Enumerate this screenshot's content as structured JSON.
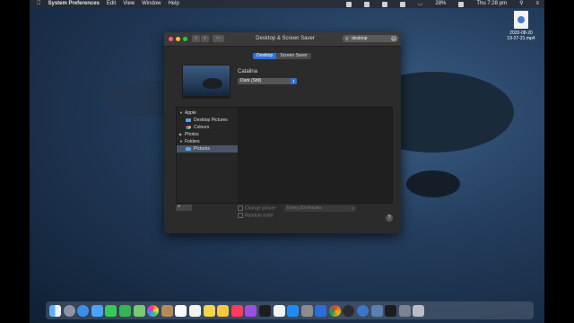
{
  "menubar": {
    "apple_icon": "apple-logo-icon",
    "app_name": "System Preferences",
    "menus": [
      "Edit",
      "View",
      "Window",
      "Help"
    ],
    "battery": "28%",
    "clock": "Thu 7:28 pm"
  },
  "desktop": {
    "file_name": "2020-08-20\n19-27-21.mp4"
  },
  "window": {
    "title": "Desktop & Screen Saver",
    "search_value": "desktop",
    "tabs": [
      "Desktop",
      "Screen Saver"
    ],
    "selected_tab": "Desktop",
    "picture_name": "Catalina",
    "appearance_mode": "Dark (Still)",
    "sidebar": [
      {
        "type": "header",
        "label": "Apple",
        "expanded": true
      },
      {
        "type": "item",
        "label": "Desktop Pictures",
        "icon": "folder-icon"
      },
      {
        "type": "item",
        "label": "Colours",
        "icon": "color-wheel-icon"
      },
      {
        "type": "header",
        "label": "Photos",
        "expanded": false
      },
      {
        "type": "header",
        "label": "Folders",
        "expanded": true
      },
      {
        "type": "item",
        "label": "Pictures",
        "icon": "folder-icon",
        "selected": true
      }
    ],
    "add_remove_label": "+",
    "change_picture_label": "Change picture:",
    "random_order_label": "Random order",
    "interval_value": "Every 30 minutes",
    "help_label": "?"
  },
  "dock": {
    "apps": [
      "Finder",
      "Launchpad",
      "Safari",
      "Mail",
      "Messages",
      "FaceTime",
      "Maps",
      "Photos",
      "Notes",
      "Calendar",
      "Reminders",
      "Contacts",
      "Stickies",
      "Podcasts",
      "Music",
      "TV",
      "News",
      "App Store",
      "Mac App",
      "Preview",
      "Chrome",
      "OBS",
      "QuickTime",
      "Preferences",
      "Screenshot",
      "Trash"
    ]
  },
  "colors": {
    "accent": "#2f6fd6",
    "window_bg": "#2b2b2b"
  }
}
